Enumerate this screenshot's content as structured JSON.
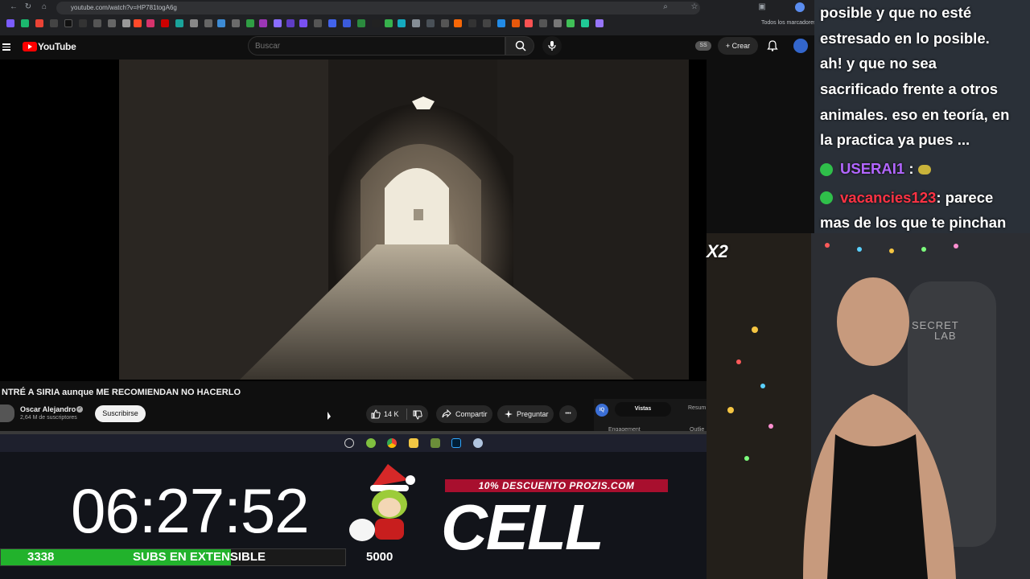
{
  "browser": {
    "url": "youtube.com/watch?v=HP781togA6g",
    "bookmarks_all": "Todos los marcadores"
  },
  "youtube": {
    "logo_text": "YouTube",
    "search_placeholder": "Buscar",
    "badge": "SS",
    "create_label": "Crear"
  },
  "video": {
    "title": "NTRÉ A SIRIA aunque ME RECOMIENDAN NO HACERLO",
    "channel_name": "Oscar Alejandro",
    "channel_subs": "2,64 M de suscriptores",
    "subscribe_label": "Suscribirse",
    "likes": "14 K",
    "share_label": "Compartir",
    "ask_label": "Preguntar",
    "more_label": "•••"
  },
  "side_panel": {
    "icon_text": "IQ",
    "tab_active": "Vistas",
    "tab_other": "Resum",
    "metric_left": "Engagement",
    "metric_right": "Outlie"
  },
  "stream_overlay": {
    "timer": "06:27:52",
    "subs_current": "3338",
    "subs_label": "SUBS EN EXTENSIBLE",
    "subs_goal": "5000",
    "subs_progress": 0.668,
    "promo": "10% DESCUENTO PROZIS.COM",
    "brand": "CELL",
    "combo": "X2"
  },
  "chat": {
    "lines": [
      "posible y que no esté",
      "estresado en lo posible.",
      "ah! y que no sea",
      "sacrificado frente a otros",
      "animales. eso en teoría, en",
      "la practica ya pues ..."
    ],
    "user1": "USERAI1",
    "user1_sep": ":",
    "user2": "vacancies123",
    "user2_msg": ": parece",
    "user2_msg2": "mas de los que te pinchan"
  },
  "webcam": {
    "chair_logo_1": "SECRET",
    "chair_logo_2": "LAB"
  },
  "colors": {
    "yt_red": "#ff0000",
    "subs_green": "#22b22c",
    "promo_red": "#a80f2e",
    "chat_user1": "#b266ff",
    "chat_user2": "#ff3344"
  }
}
